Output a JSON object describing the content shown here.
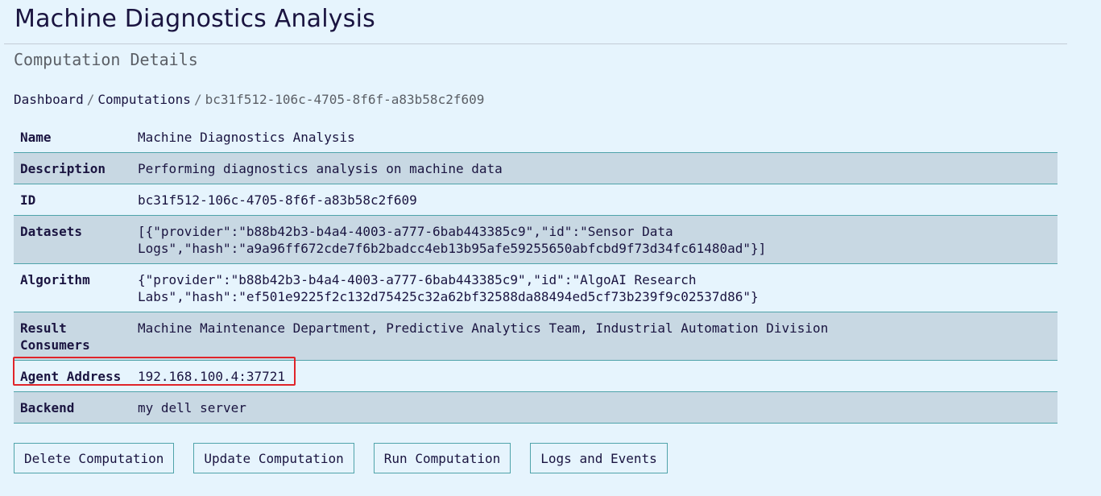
{
  "header": {
    "title": "Machine Diagnostics Analysis",
    "subtitle": "Computation Details"
  },
  "breadcrumb": {
    "items": [
      "Dashboard",
      "Computations"
    ],
    "separator": "/",
    "current": "bc31f512-106c-4705-8f6f-a83b58c2f609"
  },
  "details": [
    {
      "key": "Name",
      "value": "Machine Diagnostics Analysis"
    },
    {
      "key": "Description",
      "value": "Performing diagnostics analysis on machine data"
    },
    {
      "key": "ID",
      "value": "bc31f512-106c-4705-8f6f-a83b58c2f609"
    },
    {
      "key": "Datasets",
      "value": "[{\"provider\":\"b88b42b3-b4a4-4003-a777-6bab443385c9\",\"id\":\"Sensor Data Logs\",\"hash\":\"a9a96ff672cde7f6b2badcc4eb13b95afe59255650abfcbd9f73d34fc61480ad\"}]"
    },
    {
      "key": "Algorithm",
      "value": "{\"provider\":\"b88b42b3-b4a4-4003-a777-6bab443385c9\",\"id\":\"AlgoAI Research Labs\",\"hash\":\"ef501e9225f2c132d75425c32a62bf32588da88494ed5cf73b239f9c02537d86\"}"
    },
    {
      "key": "Result Consumers",
      "value": "Machine Maintenance Department, Predictive Analytics Team, Industrial Automation Division"
    },
    {
      "key": "Agent Address",
      "value": "192.168.100.4:37721"
    },
    {
      "key": "Backend",
      "value": "my dell server"
    }
  ],
  "actions": {
    "delete_label": "Delete Computation",
    "update_label": "Update Computation",
    "run_label": "Run Computation",
    "logs_label": "Logs and Events"
  },
  "colors": {
    "background": "#e6f4fd",
    "row_alt": "#c8d8e3",
    "border_accent": "#4fa3aa",
    "highlight": "#e0242a",
    "text": "#1a1440"
  }
}
